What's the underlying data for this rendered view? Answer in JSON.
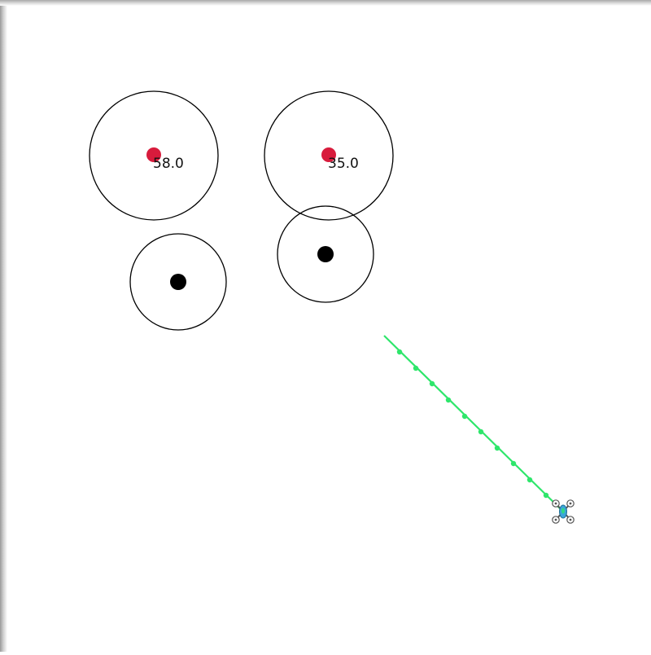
{
  "targets": [
    {
      "value": "58.0"
    },
    {
      "value": "35.0"
    }
  ],
  "obstacles": [
    {
      "label": "obstacle-left"
    },
    {
      "label": "obstacle-right"
    }
  ],
  "drone": {
    "icon": "quadcopter-drone-icon"
  },
  "path": {
    "waypoint_count": 9
  },
  "colors": {
    "target": "#d81b3c",
    "obstacle": "#000000",
    "path": "#2ee66b",
    "drone_body": "#3da5d9",
    "background": "#ffffff"
  }
}
